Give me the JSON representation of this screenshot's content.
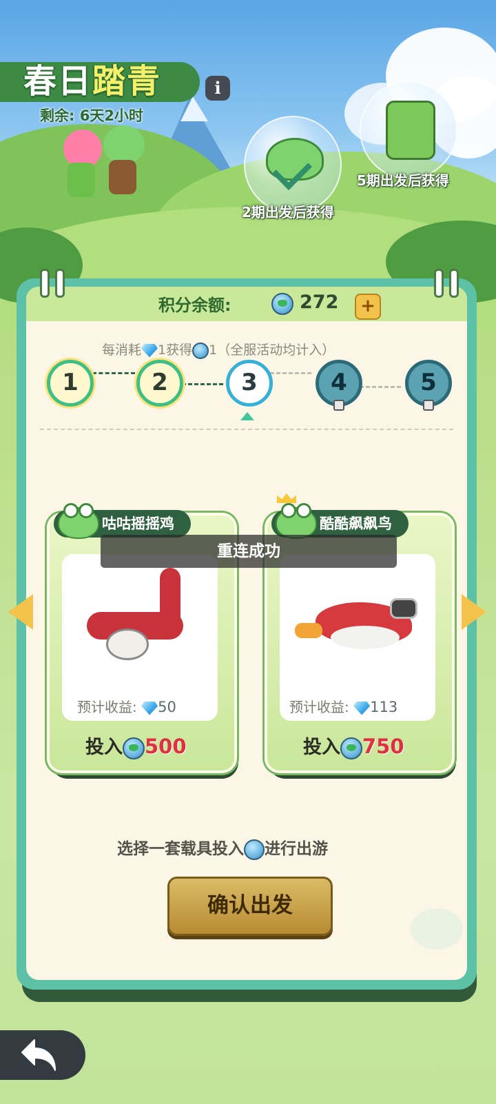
{
  "event": {
    "title_part1": "春日",
    "title_part2": "踏青",
    "remaining": "剩余: 6天2小时",
    "info_icon": "i"
  },
  "rewards": [
    {
      "label": "2期出发后获得",
      "icon": "frog-hat-icon"
    },
    {
      "label": "5期出发后获得",
      "icon": "green-jacket-icon"
    }
  ],
  "balance": {
    "label": "积分余额:",
    "value": "272",
    "plus": "+"
  },
  "rule": {
    "part1": "每消耗",
    "part2": "1获得",
    "part3": "1（全服活动均计入）"
  },
  "stages": [
    {
      "number": "1",
      "state": "done"
    },
    {
      "number": "2",
      "state": "done"
    },
    {
      "number": "3",
      "state": "current"
    },
    {
      "number": "4",
      "state": "locked"
    },
    {
      "number": "5",
      "state": "locked"
    }
  ],
  "toast": "重连成功",
  "vehicles": [
    {
      "name": "咕咕摇摇鸡",
      "profit_label": "预计收益:",
      "profit_value": "50",
      "invest_label": "投入",
      "invest_value": "500"
    },
    {
      "name": "酷酷飙飙鸟",
      "profit_label": "预计收益:",
      "profit_value": "113",
      "invest_label": "投入",
      "invest_value": "750"
    }
  ],
  "hint": {
    "part1": "选择一套载具投入",
    "part2": "进行出游"
  },
  "confirm_label": "确认出发",
  "colors": {
    "panel_border": "#5cc1a6",
    "accent_yellow": "#f3c24a",
    "invest_red": "#e0303f",
    "confirm_gold": "#c9a24a"
  }
}
